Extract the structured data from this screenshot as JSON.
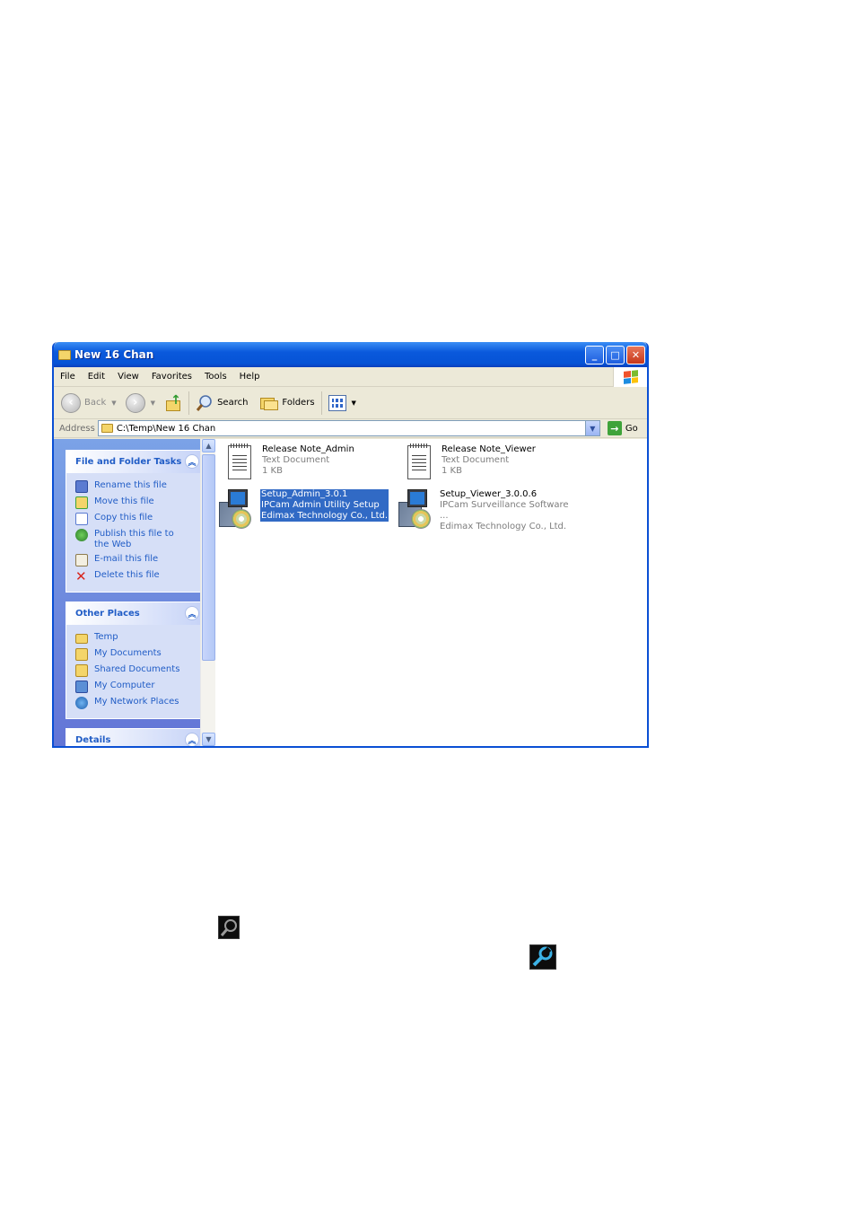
{
  "window": {
    "title": "New 16 Chan"
  },
  "menu": [
    "File",
    "Edit",
    "View",
    "Favorites",
    "Tools",
    "Help"
  ],
  "toolbar": {
    "back": "Back",
    "search": "Search",
    "folders": "Folders"
  },
  "address": {
    "label": "Address",
    "path": "C:\\Temp\\New 16 Chan",
    "go": "Go"
  },
  "task_pane": {
    "file_tasks": {
      "title": "File and Folder Tasks",
      "items": [
        {
          "label": "Rename this file",
          "icon": "rename-icon"
        },
        {
          "label": "Move this file",
          "icon": "move-icon"
        },
        {
          "label": "Copy this file",
          "icon": "copy-icon"
        },
        {
          "label": "Publish this file to the Web",
          "icon": "publish-web-icon"
        },
        {
          "label": "E-mail this file",
          "icon": "email-icon"
        },
        {
          "label": "Delete this file",
          "icon": "delete-icon"
        }
      ]
    },
    "other_places": {
      "title": "Other Places",
      "items": [
        {
          "label": "Temp",
          "icon": "folder-icon"
        },
        {
          "label": "My Documents",
          "icon": "my-documents-icon"
        },
        {
          "label": "Shared Documents",
          "icon": "shared-folder-icon"
        },
        {
          "label": "My Computer",
          "icon": "my-computer-icon"
        },
        {
          "label": "My Network Places",
          "icon": "network-icon"
        }
      ]
    },
    "details": {
      "title": "Details"
    }
  },
  "files": [
    {
      "name": "Release Note_Admin",
      "line2": "Text Document",
      "line3": "1 KB",
      "type": "text",
      "selected": false
    },
    {
      "name": "Release Note_Viewer",
      "line2": "Text Document",
      "line3": "1 KB",
      "type": "text",
      "selected": false
    },
    {
      "name": "Setup_Admin_3.0.1",
      "line2": "IPCam Admin Utility Setup",
      "line3": "Edimax Technology Co., Ltd.",
      "type": "setup",
      "selected": true
    },
    {
      "name": "Setup_Viewer_3.0.0.6",
      "line2": "IPCam Surveillance Software ...",
      "line3": "Edimax Technology Co., Ltd.",
      "type": "setup",
      "selected": false
    }
  ],
  "page_icons": [
    {
      "icon": "search-icon"
    },
    {
      "icon": "wrench-icon"
    }
  ]
}
